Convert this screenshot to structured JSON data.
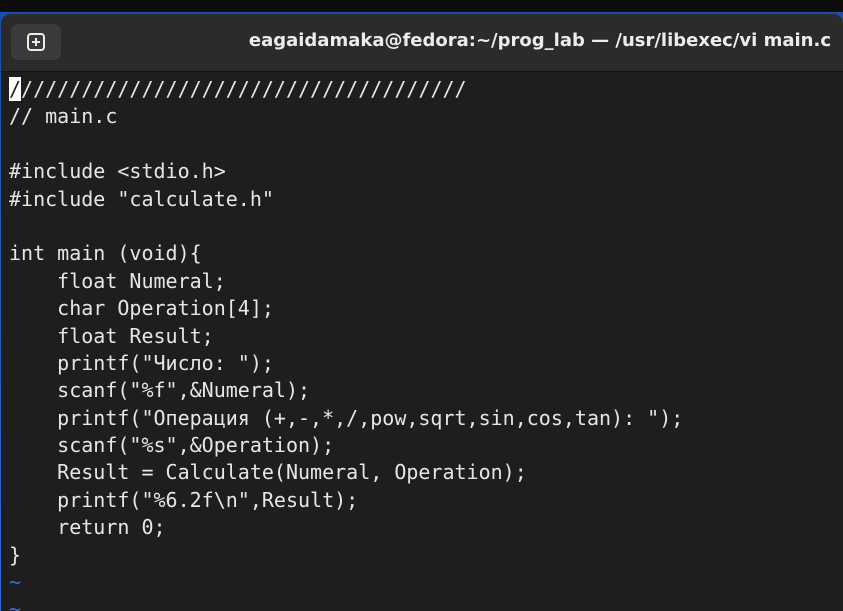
{
  "window": {
    "title": "eagaidamaka@fedora:~/prog_lab — /usr/libexec/vi main.c",
    "new_tab_icon": "plus-square-icon"
  },
  "editor": {
    "cursor_char": "/",
    "lines": [
      "//////////////////////////////////////",
      "// main.c",
      "",
      "#include <stdio.h>",
      "#include \"calculate.h\"",
      "",
      "int main (void){",
      "    float Numeral;",
      "    char Operation[4];",
      "    float Result;",
      "    printf(\"Число: \");",
      "    scanf(\"%f\",&Numeral);",
      "    printf(\"Операция (+,-,*,/,pow,sqrt,sin,cos,tan): \");",
      "    scanf(\"%s\",&Operation);",
      "    Result = Calculate(Numeral, Operation);",
      "    printf(\"%6.2f\\n\",Result);",
      "    return 0;",
      "}"
    ],
    "empty_line_marker": "~"
  },
  "colors": {
    "terminal_bg": "#1e1e1e",
    "titlebar_bg": "#2b2b2b",
    "text": "#e6e6e6",
    "tilde": "#3b6fd8"
  }
}
